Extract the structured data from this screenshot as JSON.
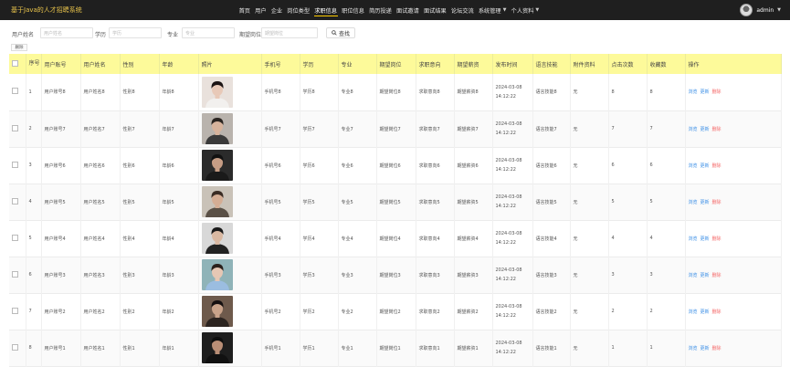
{
  "header": {
    "brand": "基于Java的人才招聘系统",
    "nav": [
      {
        "label": "首页",
        "active": false,
        "has_caret": false
      },
      {
        "label": "用户",
        "active": false,
        "has_caret": false
      },
      {
        "label": "企业",
        "active": false,
        "has_caret": false
      },
      {
        "label": "岗位类型",
        "active": false,
        "has_caret": false
      },
      {
        "label": "求职信息",
        "active": true,
        "has_caret": false
      },
      {
        "label": "职位信息",
        "active": false,
        "has_caret": false
      },
      {
        "label": "简历投递",
        "active": false,
        "has_caret": false
      },
      {
        "label": "面试邀请",
        "active": false,
        "has_caret": false
      },
      {
        "label": "面试结果",
        "active": false,
        "has_caret": false
      },
      {
        "label": "论坛交流",
        "active": false,
        "has_caret": false
      },
      {
        "label": "系统管理",
        "active": false,
        "has_caret": true
      },
      {
        "label": "个人资料",
        "active": false,
        "has_caret": true
      }
    ],
    "user": "admin"
  },
  "search": {
    "fields": [
      {
        "label": "用户姓名",
        "placeholder": "用户姓名"
      },
      {
        "label": "学历",
        "placeholder": "学历"
      },
      {
        "label": "专业",
        "placeholder": "专业"
      },
      {
        "label": "期望岗位",
        "placeholder": "期望岗位"
      }
    ],
    "button": "查找",
    "delete": "删除"
  },
  "table": {
    "columns": [
      "序号",
      "用户账号",
      "用户姓名",
      "性别",
      "年龄",
      "照片",
      "手机号",
      "学历",
      "专业",
      "期望岗位",
      "求职意向",
      "期望薪资",
      "发布时间",
      "语言技能",
      "附件资料",
      "点击次数",
      "收藏数",
      "操作"
    ],
    "actions": {
      "view": "浏览",
      "edit": "更新",
      "delete": "删除"
    },
    "rows": [
      {
        "no": "1",
        "account": "用户账号8",
        "name": "用户姓名8",
        "gender": "性别8",
        "age": "年龄8",
        "phone": "手机号8",
        "edu": "学历8",
        "major": "专业8",
        "position": "期望岗位8",
        "intention": "求职意向8",
        "salary": "期望薪资8",
        "time": "2024-03-08 14:12:22",
        "skill": "语言技能8",
        "attach": "无",
        "clicks": "8",
        "favs": "8",
        "photo": {
          "bg": "#e9e1dc",
          "hair": "#1c1414",
          "skin": "#e8c9b8",
          "cloth": "#f2f0ee"
        }
      },
      {
        "no": "2",
        "account": "用户账号7",
        "name": "用户姓名7",
        "gender": "性别7",
        "age": "年龄7",
        "phone": "手机号7",
        "edu": "学历7",
        "major": "专业7",
        "position": "期望岗位7",
        "intention": "求职意向7",
        "salary": "期望薪资7",
        "time": "2024-03-08 14:12:22",
        "skill": "语言技能7",
        "attach": "无",
        "clicks": "7",
        "favs": "7",
        "photo": {
          "bg": "#b9b3ad",
          "hair": "#2a2420",
          "skin": "#d7b39c",
          "cloth": "#3a3a3a"
        }
      },
      {
        "no": "3",
        "account": "用户账号6",
        "name": "用户姓名6",
        "gender": "性别6",
        "age": "年龄6",
        "phone": "手机号6",
        "edu": "学历6",
        "major": "专业6",
        "position": "期望岗位6",
        "intention": "求职意向6",
        "salary": "期望薪资6",
        "time": "2024-03-08 14:12:22",
        "skill": "语言技能6",
        "attach": "无",
        "clicks": "6",
        "favs": "6",
        "photo": {
          "bg": "#2b2b2b",
          "hair": "#111111",
          "skin": "#c69d85",
          "cloth": "#1a1a1a"
        }
      },
      {
        "no": "4",
        "account": "用户账号5",
        "name": "用户姓名5",
        "gender": "性别5",
        "age": "年龄5",
        "phone": "手机号5",
        "edu": "学历5",
        "major": "专业5",
        "position": "期望岗位5",
        "intention": "求职意向5",
        "salary": "期望薪资5",
        "time": "2024-03-08 14:12:22",
        "skill": "语言技能5",
        "attach": "无",
        "clicks": "5",
        "favs": "5",
        "photo": {
          "bg": "#c9c2b8",
          "hair": "#3a2c24",
          "skin": "#d4ad94",
          "cloth": "#5a5046"
        }
      },
      {
        "no": "5",
        "account": "用户账号4",
        "name": "用户姓名4",
        "gender": "性别4",
        "age": "年龄4",
        "phone": "手机号4",
        "edu": "学历4",
        "major": "专业4",
        "position": "期望岗位4",
        "intention": "求职意向4",
        "salary": "期望薪资4",
        "time": "2024-03-08 14:12:22",
        "skill": "语言技能4",
        "attach": "无",
        "clicks": "4",
        "favs": "4",
        "photo": {
          "bg": "#d8d8d8",
          "hair": "#1a1a1a",
          "skin": "#d9b8a2",
          "cloth": "#222222"
        }
      },
      {
        "no": "6",
        "account": "用户账号3",
        "name": "用户姓名3",
        "gender": "性别3",
        "age": "年龄3",
        "phone": "手机号3",
        "edu": "学历3",
        "major": "专业3",
        "position": "期望岗位3",
        "intention": "求职意向3",
        "salary": "期望薪资3",
        "time": "2024-03-08 14:12:22",
        "skill": "语言技能3",
        "attach": "无",
        "clicks": "3",
        "favs": "3",
        "photo": {
          "bg": "#8fb3b8",
          "hair": "#2a201c",
          "skin": "#e6c7b4",
          "cloth": "#9bbde0"
        }
      },
      {
        "no": "7",
        "account": "用户账号2",
        "name": "用户姓名2",
        "gender": "性别2",
        "age": "年龄2",
        "phone": "手机号2",
        "edu": "学历2",
        "major": "专业2",
        "position": "期望岗位2",
        "intention": "求职意向2",
        "salary": "期望薪资2",
        "time": "2024-03-08 14:12:22",
        "skill": "语言技能2",
        "attach": "无",
        "clicks": "2",
        "favs": "2",
        "photo": {
          "bg": "#6e5a4c",
          "hair": "#151010",
          "skin": "#c9a38a",
          "cloth": "#2c2420"
        }
      },
      {
        "no": "8",
        "account": "用户账号1",
        "name": "用户姓名1",
        "gender": "性别1",
        "age": "年龄1",
        "phone": "手机号1",
        "edu": "学历1",
        "major": "专业1",
        "position": "期望岗位1",
        "intention": "求职意向1",
        "salary": "期望薪资1",
        "time": "2024-03-08 14:12:22",
        "skill": "语言技能1",
        "attach": "无",
        "clicks": "1",
        "favs": "1",
        "photo": {
          "bg": "#1e1e1e",
          "hair": "#0e0e0e",
          "skin": "#b98e76",
          "cloth": "#111111"
        }
      }
    ]
  },
  "colors": {
    "header_bg": "#1f1f1f",
    "brand": "#e8c34b",
    "table_header": "#fdfa9a",
    "link": "#3a8ee6",
    "danger": "#f56c6c"
  }
}
